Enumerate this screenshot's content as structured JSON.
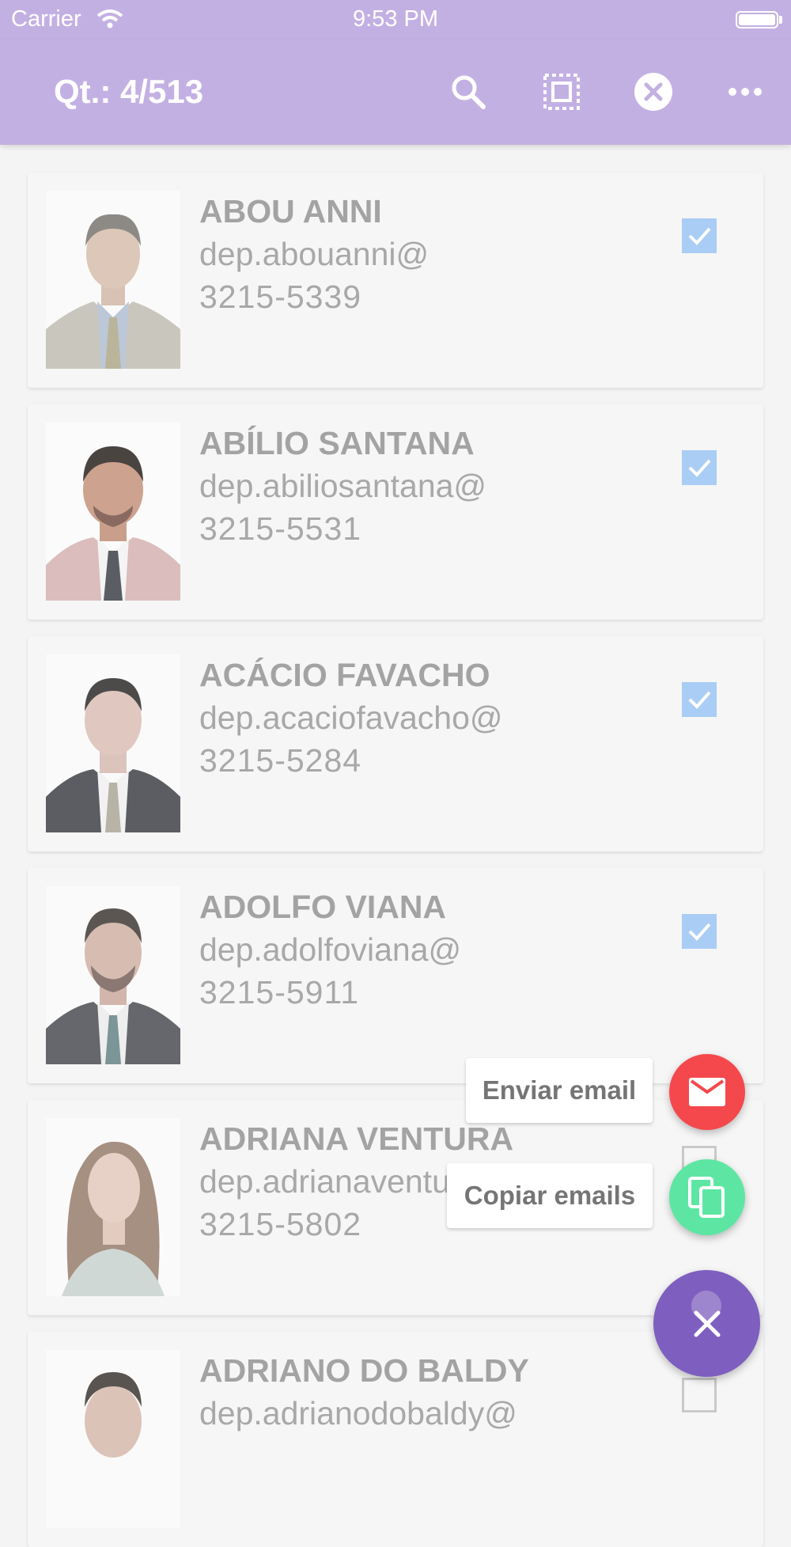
{
  "status_bar": {
    "carrier": "Carrier",
    "time": "9:53 PM"
  },
  "app_bar": {
    "title": "Qt.: 4/513",
    "icons": [
      "search-icon",
      "select-all-icon",
      "clear-selection-icon",
      "more-options-icon"
    ]
  },
  "contacts": [
    {
      "name": "ABOU ANNI",
      "email": "dep.abouanni@",
      "phone": "3215-5339",
      "checked": true
    },
    {
      "name": "ABÍLIO SANTANA",
      "email": "dep.abiliosantana@",
      "phone": "3215-5531",
      "checked": true
    },
    {
      "name": "ACÁCIO FAVACHO",
      "email": "dep.acaciofavacho@",
      "phone": "3215-5284",
      "checked": true
    },
    {
      "name": "ADOLFO VIANA",
      "email": "dep.adolfoviana@",
      "phone": "3215-5911",
      "checked": true
    },
    {
      "name": "ADRIANA VENTURA",
      "email": "dep.adrianaventura@",
      "phone": "3215-5802",
      "checked": false
    },
    {
      "name": "ADRIANO DO BALDY",
      "email": "dep.adrianodobaldy@",
      "phone": "",
      "checked": false
    }
  ],
  "fab_menu": {
    "send_email_label": "Enviar email",
    "copy_emails_label": "Copiar emails",
    "colors": {
      "send": "#f4484c",
      "copy": "#5de6a3",
      "main": "#7e5ebf"
    }
  },
  "colors": {
    "header": "#c3b0e3",
    "checkbox_checked": "#a9cdf5"
  }
}
